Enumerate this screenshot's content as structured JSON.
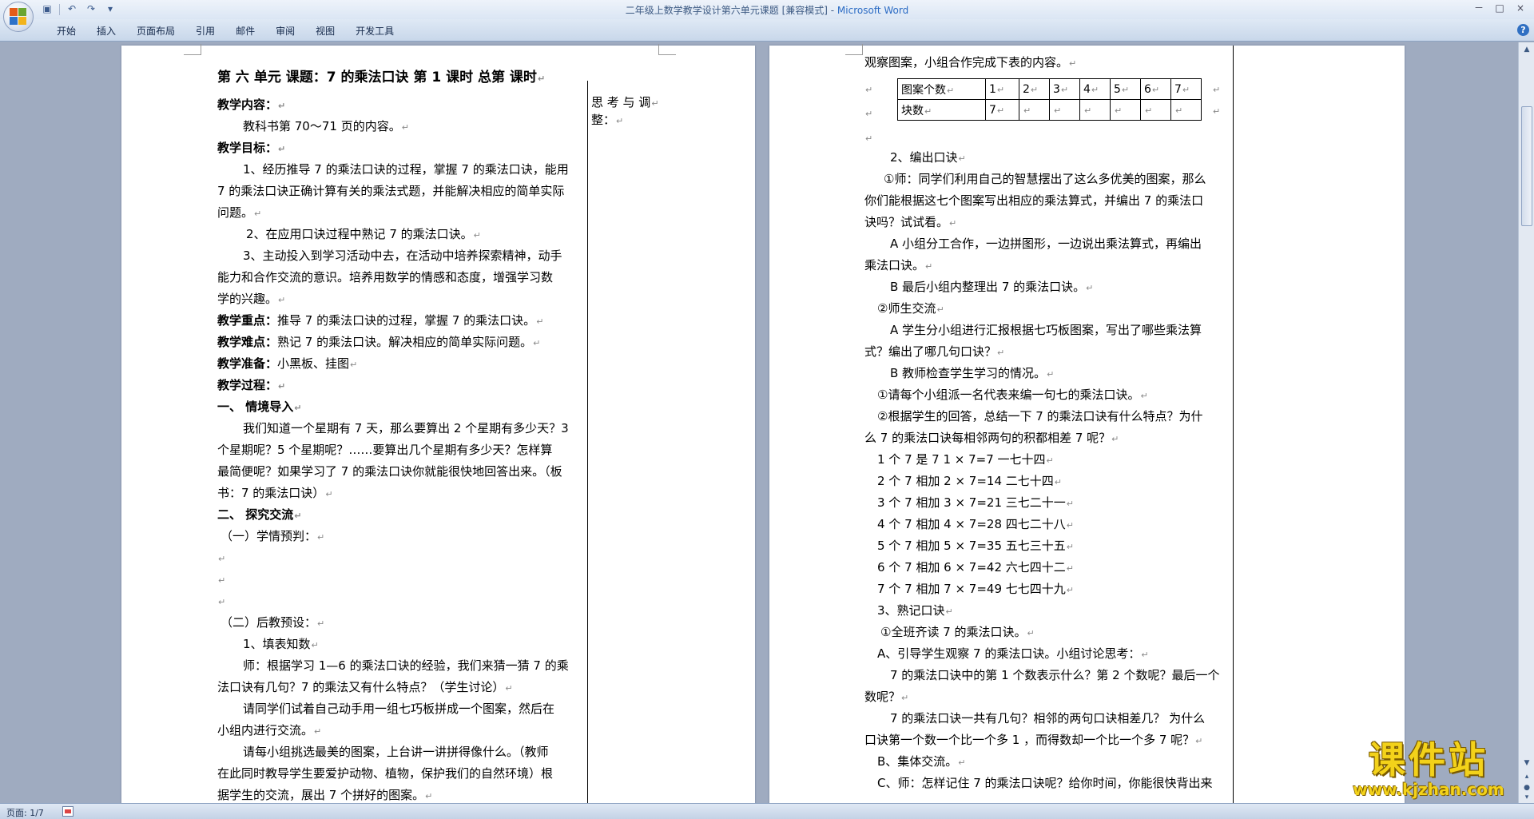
{
  "window": {
    "title": "二年级上数学教学设计第六单元课题 [兼容模式] - ",
    "app_name": "Microsoft Word",
    "controls": [
      "－",
      "□",
      "×"
    ]
  },
  "quick_access": [
    "save-icon",
    "undo-icon",
    "redo-icon"
  ],
  "ribbon_tabs": [
    "开始",
    "插入",
    "页面布局",
    "引用",
    "邮件",
    "审阅",
    "视图",
    "开发工具"
  ],
  "page1": {
    "header": "第 六 单元    课题：7 的乘法口诀       第 1 课时      总第     课时",
    "side_note_1": "思 考 与 调",
    "side_note_2": "整：",
    "lines": [
      "教学内容：",
      "教科书第 70～71 页的内容。",
      "教学目标：",
      "1、经历推导 7 的乘法口诀的过程，掌握 7 的乘法口诀，能用",
      "7 的乘法口诀正确计算有关的乘法式题，并能解决相应的简单实际",
      "问题。",
      "2、在应用口诀过程中熟记 7 的乘法口诀。",
      "3、主动投入到学习活动中去，在活动中培养探索精神，动手",
      "能力和合作交流的意识。培养用数学的情感和态度，增强学习数",
      "学的兴趣。",
      "推导 7 的乘法口诀的过程，掌握 7 的乘法口诀。",
      "熟记 7 的乘法口诀。解决相应的简单实际问题。",
      "小黑板、挂图",
      "教学过程：",
      "一、 情境导入",
      "我们知道一个星期有 7 天，那么要算出 2 个星期有多少天？3",
      "个星期呢？5 个星期呢？……要算出几个星期有多少天？怎样算",
      "最简便呢？如果学习了 7 的乘法口诀你就能很快地回答出来。（板",
      "书：7 的乘法口诀）",
      "二、 探究交流",
      "（一）学情预判：",
      "",
      "",
      "",
      "（二）后教预设：",
      "1、填表知数",
      "师：根据学习 1—6 的乘法口诀的经验，我们来猜一猜 7 的乘",
      "法口诀有几句？7 的乘法又有什么特点？（学生讨论）",
      "请同学们试着自己动手用一组七巧板拼成一个图案，然后在",
      "小组内进行交流。",
      "请每小组挑选最美的图案，上台讲一讲拼得像什么。（教师",
      "在此同时教导学生要爱护动物、植物，保护我们的自然环境）根",
      "据学生的交流，展出 7 个拼好的图案。"
    ],
    "labels": {
      "key": "教学重点：",
      "difficult": "教学难点：",
      "prep": "教学准备："
    }
  },
  "page2": {
    "intro": "观察图案，小组合作完成下表的内容。",
    "table": {
      "row1": [
        "图案个数",
        "1",
        "2",
        "3",
        "4",
        "5",
        "6",
        "7"
      ],
      "row2": [
        "块数",
        "7",
        "",
        "",
        "",
        "",
        "",
        ""
      ]
    },
    "lines": [
      "2、编出口诀",
      "①师：同学们利用自己的智慧摆出了这么多优美的图案，那么",
      "你们能根据这七个图案写出相应的乘法算式，并编出 7 的乘法口",
      "诀吗？试试看。",
      "A 小组分工合作，一边拼图形，一边说出乘法算式，再编出",
      "乘法口诀。",
      "B 最后小组内整理出 7 的乘法口诀。",
      "②师生交流",
      "A 学生分小组进行汇报根据七巧板图案，写出了哪些乘法算",
      "式？编出了哪几句口诀？",
      "B 教师检查学生学习的情况。",
      "①请每个小组派一名代表来编一句七的乘法口诀。",
      "②根据学生的回答，总结一下  7 的乘法口诀有什么特点？为什",
      "么 7 的乘法口诀每相邻两句的积都相差 7 呢？",
      "1 个 7 是 7    1 × 7=7       一七十四",
      "2 个 7 相加   2 × 7=14      二七十四",
      "3 个 7 相加   3 × 7=21      三七二十一",
      "4 个 7 相加   4 × 7=28      四七二十八",
      "5 个 7 相加   5 × 7=35      五七三十五",
      "6 个 7 相加   6 × 7=42      六七四十二",
      "7 个 7 相加   7 × 7=49      七七四十九",
      "3、熟记口诀",
      "①全班齐读 7 的乘法口诀。",
      "A、引导学生观察 7 的乘法口诀。小组讨论思考：",
      "7 的乘法口诀中的第 1 个数表示什么？第 2 个数呢？最后一个",
      "数呢？",
      "7 的乘法口诀一共有几句？相邻的两句口诀相差几？  为什么",
      "口诀第一个数一个比一个多 1 ，而得数却一个比一个多 7 呢？",
      "B、集体交流。",
      "C、师：怎样记住 7 的乘法口诀呢？给你时间，你能很快背出来"
    ]
  },
  "status": {
    "page": "页面: 1/7"
  },
  "watermark": {
    "title": "课件站",
    "url": "www.kjzhan.com"
  },
  "colors": {
    "workspace": "#9fabc0",
    "title_app": "#2b6bc4",
    "watermark": "#f3d21a"
  }
}
